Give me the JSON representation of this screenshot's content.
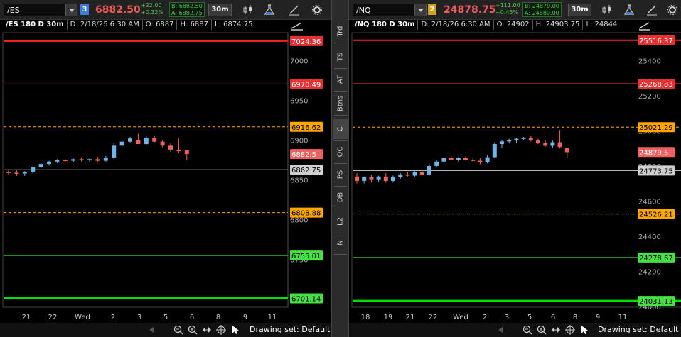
{
  "sidebar": {
    "tabs": [
      {
        "label": "Trd"
      },
      {
        "label": "TS"
      },
      {
        "label": "AT"
      },
      {
        "label": "Btns"
      },
      {
        "label": "C"
      },
      {
        "label": "OC"
      },
      {
        "label": "PS"
      },
      {
        "label": "DB"
      },
      {
        "label": "L2"
      },
      {
        "label": "N"
      }
    ],
    "active": "C"
  },
  "panels": [
    {
      "id": "es",
      "symbol": "/ES",
      "link_group": "3",
      "link_color": "#3a7bd5",
      "last": "6882.50",
      "change": "+22.00",
      "change_pct": "+0.32%",
      "bid": "B: 6882.50",
      "ask": "A: 6882.75",
      "timeframe": "30m",
      "info": {
        "title": "/ES 180 D 30m",
        "date": "D: 2/18/26 6:30 AM",
        "open": "O: 6887",
        "high": "H: 6887",
        "low": "L: 6874.75"
      },
      "drawing_set": "Drawing set: Default",
      "price_axis": {
        "min": 6690,
        "max": 7035,
        "ticks": [
          "7000",
          "6950",
          "6900",
          "6850",
          "6800",
          "6750",
          "6700"
        ]
      },
      "levels": [
        {
          "value": 7024.36,
          "label": "7024.36",
          "color": "#ff2020",
          "style": "solid",
          "width": 2
        },
        {
          "value": 6970.49,
          "label": "6970.49",
          "color": "#ff3030",
          "style": "solid",
          "width": 1
        },
        {
          "value": 6916.62,
          "label": "6916.62",
          "color": "#ffa500",
          "style": "dashed",
          "width": 1
        },
        {
          "value": 6862.75,
          "label": "6862.75",
          "color": "#d0d0d0",
          "style": "solid",
          "width": 1
        },
        {
          "value": 6808.88,
          "label": "6808.88",
          "color": "#ffa500",
          "style": "dashed",
          "width": 1
        },
        {
          "value": 6755.01,
          "label": "6755.01",
          "color": "#33dd33",
          "style": "solid",
          "width": 1
        },
        {
          "value": 6701.14,
          "label": "6701.14",
          "color": "#00e000",
          "style": "solid",
          "width": 3
        }
      ],
      "last_label": "6882.5",
      "x_axis": [
        "21",
        "22",
        "Wed",
        "2",
        "3",
        "5",
        "6",
        "8",
        "9",
        "11"
      ],
      "candles": [
        [
          6860,
          6862,
          6856,
          6859
        ],
        [
          6859,
          6862,
          6855,
          6858
        ],
        [
          6858,
          6861,
          6855,
          6860
        ],
        [
          6860,
          6867,
          6858,
          6866
        ],
        [
          6866,
          6871,
          6864,
          6870
        ],
        [
          6870,
          6874,
          6868,
          6873
        ],
        [
          6873,
          6876,
          6871,
          6875
        ],
        [
          6875,
          6876,
          6872,
          6874
        ],
        [
          6874,
          6877,
          6872,
          6876
        ],
        [
          6876,
          6878,
          6873,
          6875
        ],
        [
          6875,
          6877,
          6872,
          6876
        ],
        [
          6876,
          6879,
          6873,
          6874
        ],
        [
          6874,
          6880,
          6873,
          6878
        ],
        [
          6878,
          6896,
          6876,
          6893
        ],
        [
          6893,
          6900,
          6890,
          6898
        ],
        [
          6898,
          6904,
          6897,
          6902
        ],
        [
          6900,
          6908,
          6897,
          6895
        ],
        [
          6895,
          6906,
          6893,
          6903
        ],
        [
          6903,
          6905,
          6897,
          6898
        ],
        [
          6898,
          6900,
          6891,
          6893
        ],
        [
          6893,
          6896,
          6885,
          6888
        ],
        [
          6888,
          6902,
          6884,
          6886
        ],
        [
          6887,
          6887,
          6874.75,
          6882.5
        ]
      ]
    },
    {
      "id": "nq",
      "symbol": "/NQ",
      "link_group": "2",
      "link_color": "#d4a017",
      "last": "24878.75",
      "change": "+111.00",
      "change_pct": "+0.45%",
      "bid": "B: 24879.00",
      "ask": "A: 24880.00",
      "timeframe": "30m",
      "info": {
        "title": "/NQ 180 D 30m",
        "date": "D: 2/18/26 6:30 AM",
        "open": "O: 24902",
        "high": "H: 24903.75",
        "low": "L: 24844"
      },
      "drawing_set": "Drawing set: Default",
      "price_axis": {
        "min": 23995,
        "max": 25560,
        "ticks": [
          "25400",
          "25200",
          "25000",
          "24800",
          "24600",
          "24400",
          "24200",
          "24000"
        ]
      },
      "levels": [
        {
          "value": 25516.37,
          "label": "25516.37",
          "color": "#ff2020",
          "style": "solid",
          "width": 2
        },
        {
          "value": 25268.83,
          "label": "25268.83",
          "color": "#ff3030",
          "style": "solid",
          "width": 1
        },
        {
          "value": 25021.29,
          "label": "25021.29",
          "color": "#ffa500",
          "style": "dashed",
          "width": 1
        },
        {
          "value": 24773.75,
          "label": "24773.75",
          "color": "#d0d0d0",
          "style": "solid",
          "width": 1
        },
        {
          "value": 24526.21,
          "label": "24526.21",
          "color": "#ffa500",
          "style": "dashed",
          "width": 1
        },
        {
          "value": 24278.67,
          "label": "24278.67",
          "color": "#33dd33",
          "style": "solid",
          "width": 1
        },
        {
          "value": 24031.13,
          "label": "24031.13",
          "color": "#00e000",
          "style": "solid",
          "width": 3
        }
      ],
      "last_label": "24879.5",
      "x_axis": [
        "18",
        "19",
        "21",
        "22",
        "Wed",
        "2",
        "3",
        "5",
        "6",
        "8",
        "9",
        "11"
      ],
      "candles": [
        [
          24740,
          24760,
          24700,
          24715
        ],
        [
          24715,
          24740,
          24700,
          24735
        ],
        [
          24735,
          24750,
          24705,
          24720
        ],
        [
          24720,
          24745,
          24710,
          24740
        ],
        [
          24740,
          24760,
          24705,
          24715
        ],
        [
          24715,
          24745,
          24705,
          24738
        ],
        [
          24738,
          24760,
          24725,
          24752
        ],
        [
          24752,
          24765,
          24740,
          24745
        ],
        [
          24745,
          24770,
          24740,
          24765
        ],
        [
          24765,
          24775,
          24745,
          24750
        ],
        [
          24750,
          24810,
          24745,
          24800
        ],
        [
          24800,
          24835,
          24795,
          24825
        ],
        [
          24825,
          24850,
          24815,
          24845
        ],
        [
          24845,
          24855,
          24830,
          24835
        ],
        [
          24835,
          24850,
          24825,
          24845
        ],
        [
          24845,
          24855,
          24830,
          24835
        ],
        [
          24835,
          24848,
          24820,
          24830
        ],
        [
          24830,
          24845,
          24810,
          24820
        ],
        [
          24820,
          24860,
          24815,
          24850
        ],
        [
          24850,
          24935,
          24845,
          24925
        ],
        [
          24925,
          24950,
          24905,
          24940
        ],
        [
          24940,
          24955,
          24930,
          24948
        ],
        [
          24948,
          24960,
          24930,
          24955
        ],
        [
          24955,
          24965,
          24945,
          24960
        ],
        [
          24960,
          24970,
          24940,
          24945
        ],
        [
          24945,
          24955,
          24925,
          24930
        ],
        [
          24930,
          24945,
          24910,
          24915
        ],
        [
          24915,
          24945,
          24905,
          24935
        ],
        [
          24935,
          25005,
          24900,
          24908
        ],
        [
          24902,
          24903.75,
          24844,
          24878.75
        ]
      ]
    }
  ]
}
